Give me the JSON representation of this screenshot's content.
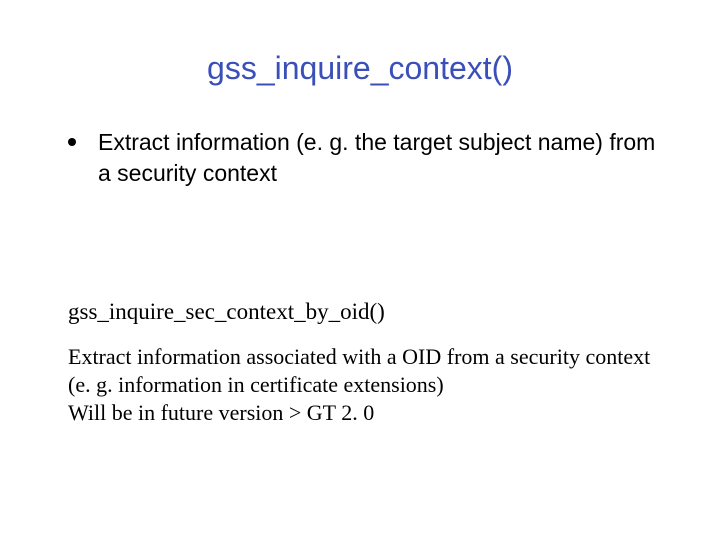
{
  "slide": {
    "title": "gss_inquire_context()",
    "bullet1": "Extract information (e. g. the target subject name) from a security context",
    "second_title": "gss_inquire_sec_context_by_oid()",
    "second_body_line1": "Extract information associated with a OID from a security context (e. g. information in certificate extensions)",
    "second_body_line2": "Will be in future version > GT 2. 0"
  }
}
